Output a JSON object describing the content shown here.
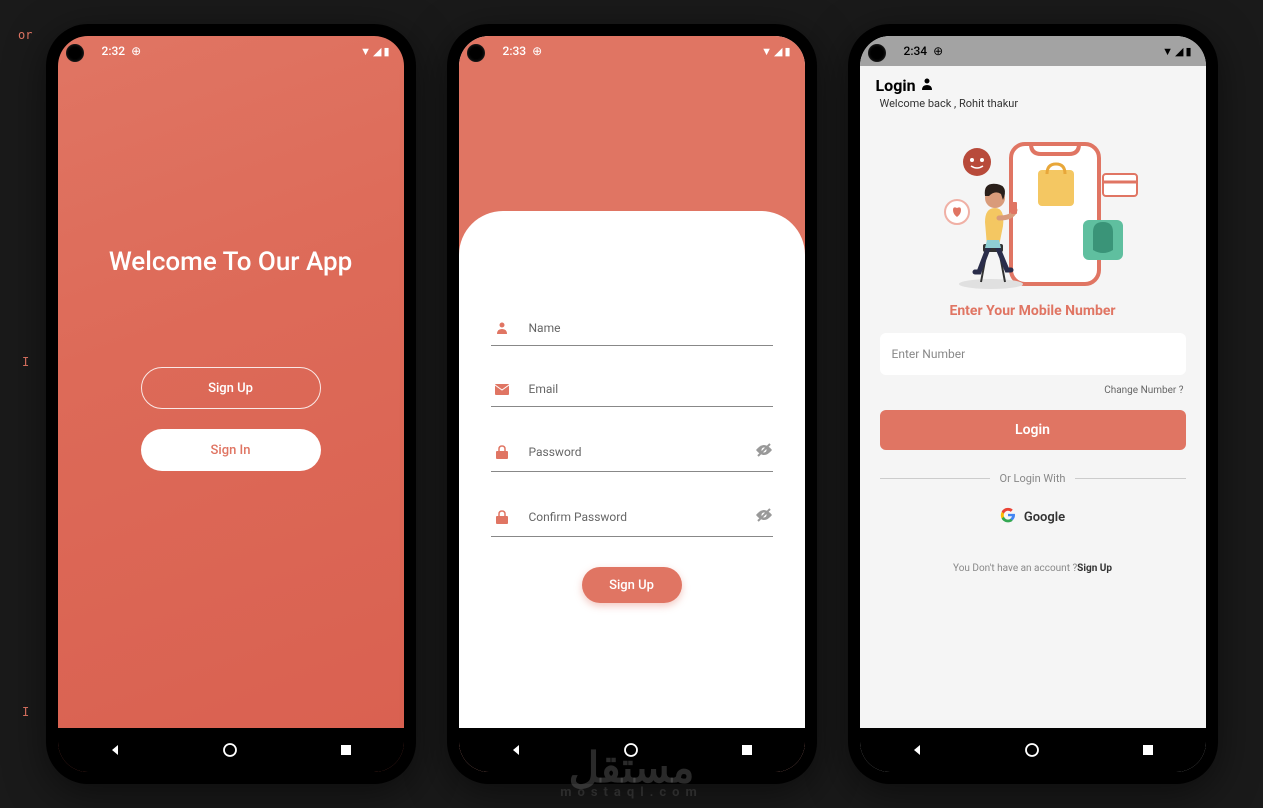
{
  "screen1": {
    "status_time": "2:32",
    "title": "Welcome To Our App",
    "signup_label": "Sign Up",
    "signin_label": "Sign In"
  },
  "screen2": {
    "status_time": "2:33",
    "fields": {
      "name_placeholder": "Name",
      "email_placeholder": "Email",
      "password_placeholder": "Password",
      "confirm_placeholder": "Confirm Password"
    },
    "signup_label": "Sign Up"
  },
  "screen3": {
    "status_time": "2:34",
    "login_title": "Login",
    "welcome_text": "Welcome back , Rohit thakur",
    "prompt": "Enter Your Mobile Number",
    "number_placeholder": "Enter Number",
    "change_number": "Change Number ?",
    "login_label": "Login",
    "divider_text": "Or Login With",
    "google_label": "Google",
    "footer_text": "You Don't have an account ?",
    "footer_action": "Sign Up"
  },
  "watermark": {
    "main": "مستقل",
    "sub": "mostaql.com"
  }
}
